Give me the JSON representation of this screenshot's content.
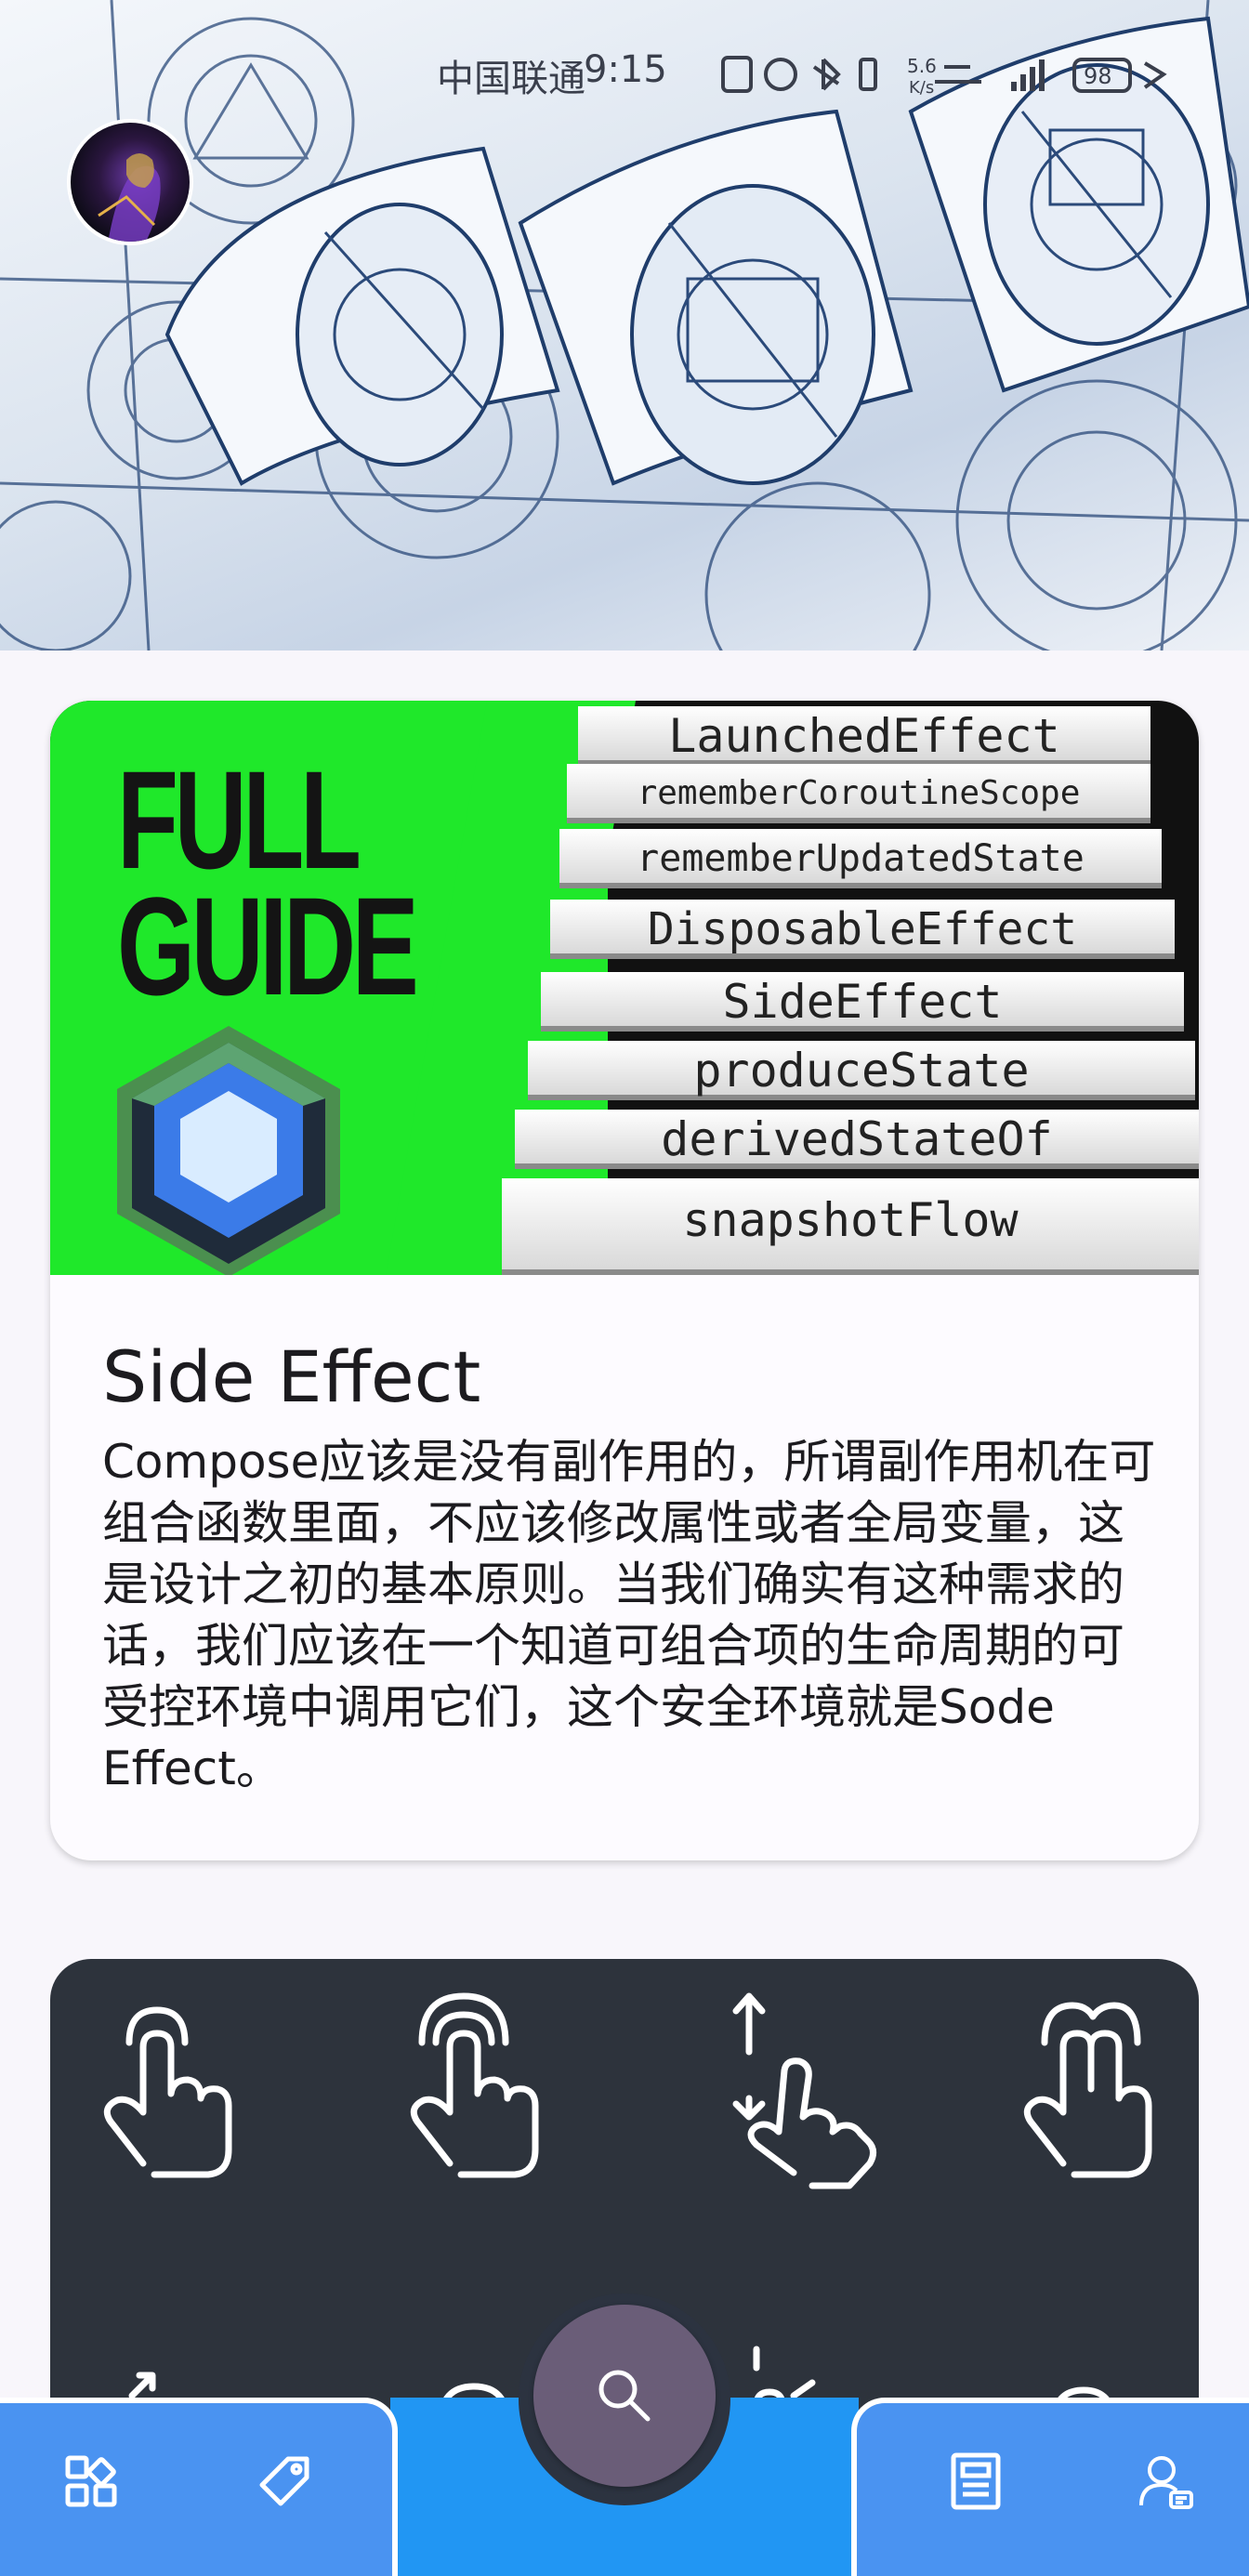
{
  "status_bar": {
    "carrier": "中国联通",
    "time": "9:15",
    "network_speed": "5.6 K/s",
    "battery": "98"
  },
  "cards": [
    {
      "image": {
        "headline": "FULL GUIDE",
        "steps": [
          "LaunchedEffect",
          "rememberCoroutineScope",
          "rememberUpdatedState",
          "DisposableEffect",
          "SideEffect",
          "produceState",
          "derivedStateOf",
          "snapshotFlow"
        ]
      },
      "title": "Side Effect",
      "body": "Compose应该是没有副作用的，所谓副作用机在可组合函数里面，不应该修改属性或者全局变量，这是设计之初的基本原则。当我们确实有这种需求的话，我们应该在一个知道可组合项的生命周期的可受控环境中调用它们，这个安全环境就是Sode Effect。"
    },
    {
      "image_icons": [
        "tap-gesture-icon",
        "double-tap-gesture-icon",
        "drag-vertical-gesture-icon",
        "two-finger-tap-gesture-icon"
      ]
    }
  ],
  "bottom_nav": {
    "left": [
      "grid-icon",
      "tag-icon"
    ],
    "center": "search-icon",
    "right": [
      "article-icon",
      "profile-icon"
    ]
  },
  "colors": {
    "nav_blue": "#4a93f1",
    "nav_center_blue": "#2196f3",
    "fab": "#6a5d78",
    "card_dark": "#2d333c",
    "neon_green": "#1fe82a"
  }
}
